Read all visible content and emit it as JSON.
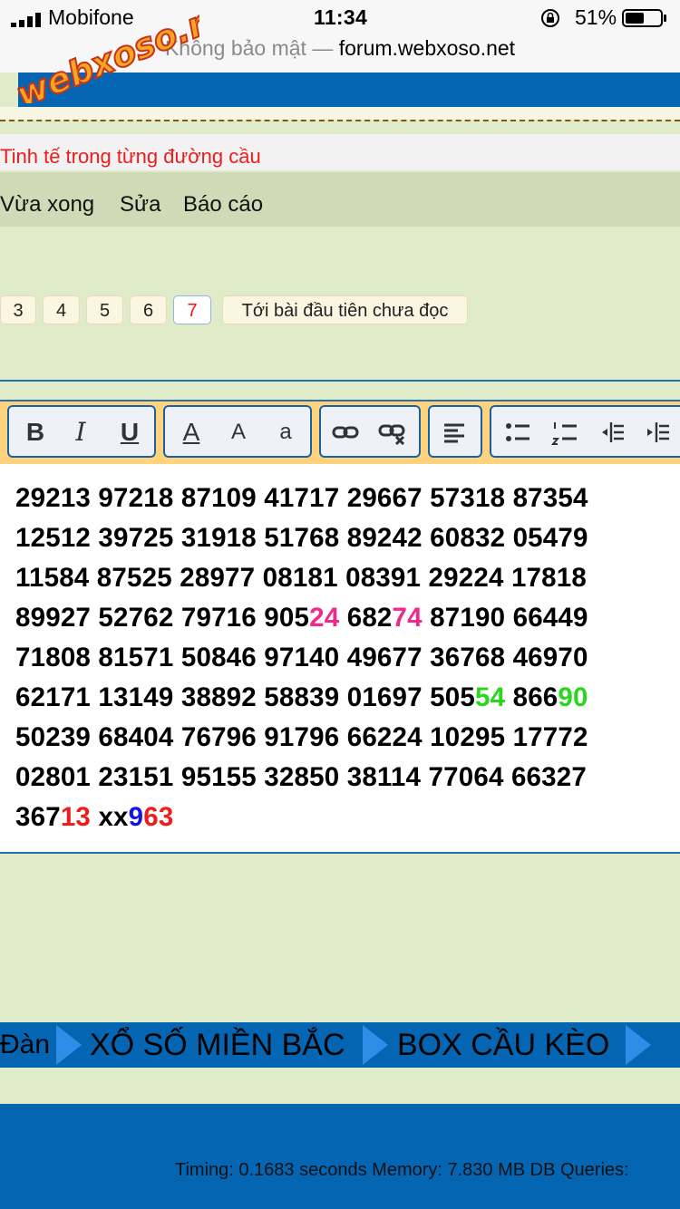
{
  "status_bar": {
    "carrier": "Mobifone",
    "time": "11:34",
    "battery": "51%"
  },
  "browser": {
    "insecure_label": "Không bảo mật —",
    "domain": "forum.webxoso.net"
  },
  "logo_text": "webxoso.net",
  "slogan": "Tinh tế trong từng đường cầu",
  "post_actions": [
    "Vừa xong",
    "Sửa",
    "Báo cáo"
  ],
  "pagination": {
    "pages": [
      "3",
      "4",
      "5",
      "6",
      "7"
    ],
    "current": "7",
    "first_unread": "Tới bài đầu tiên chưa đọc"
  },
  "editor_toolbar": {
    "icons": [
      "bold-icon",
      "italic-icon",
      "underline-icon",
      "font-color-icon",
      "font-size-icon",
      "font-family-icon",
      "link-icon",
      "unlink-icon",
      "align-left-icon",
      "bullet-list-icon",
      "numbered-list-icon",
      "outdent-icon",
      "indent-icon"
    ],
    "bold": "B",
    "italic": "I",
    "underline": "U",
    "font_color": "A",
    "font_size": "A",
    "font_family": "a"
  },
  "editor_lines": [
    [
      {
        "t": "29213 97218 87109 41717 29667 57318 87354"
      }
    ],
    [
      {
        "t": "12512 39725 31918 51768 89242 60832 05479"
      }
    ],
    [
      {
        "t": "11584 87525 28977 08181 08391 29224 17818"
      }
    ],
    [
      {
        "t": "89927 52762 79716 905"
      },
      {
        "t": "24",
        "c": "pk"
      },
      {
        "t": " 682"
      },
      {
        "t": "74",
        "c": "pk"
      },
      {
        "t": " 87190 66449"
      }
    ],
    [
      {
        "t": "71808 81571 50846 97140 49677 36768 46970"
      }
    ],
    [
      {
        "t": "62171 13149 38892 58839 01697 505"
      },
      {
        "t": "54",
        "c": "gr"
      },
      {
        "t": " 866"
      },
      {
        "t": "90",
        "c": "gr"
      }
    ],
    [
      {
        "t": "50239 68404 76796 91796 66224 10295 17772"
      }
    ],
    [
      {
        "t": "02801 23151 95155 32850 38114 77064 66327"
      }
    ],
    [
      {
        "t": "367"
      },
      {
        "t": "13",
        "c": "rd"
      },
      {
        "t": " xx"
      },
      {
        "t": "9",
        "c": "bl"
      },
      {
        "t": "63",
        "c": "rd"
      }
    ]
  ],
  "colors": {
    "pink": "#ef2a8c",
    "green": "#28d81c",
    "red": "#ef1c1c",
    "blue": "#1414e6",
    "brand_blue": "#0465b2"
  },
  "bottom_nav": [
    "Đàn",
    "XỔ SỐ MIỀN BẮC",
    "BOX CẦU KÈO"
  ],
  "footer": "Timing: 0.1683 seconds Memory: 7.830 MB DB Queries:"
}
